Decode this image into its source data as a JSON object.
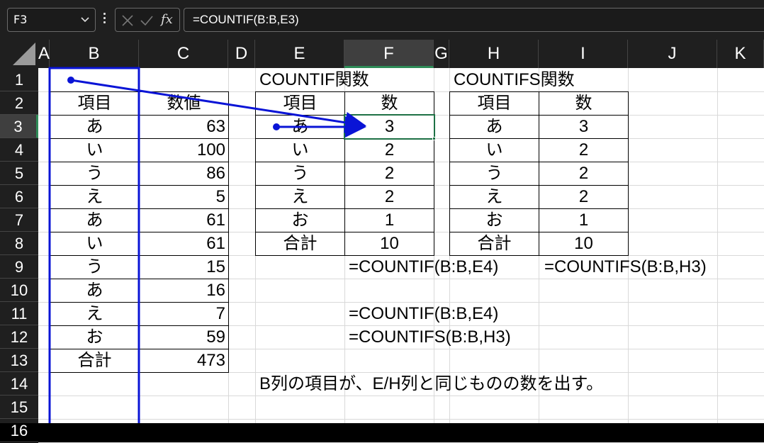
{
  "formula_bar": {
    "name_box": "F3",
    "formula": "=COUNTIF(B:B,E3)",
    "icons": [
      "chevron-down-icon",
      "more-icon",
      "cancel-icon",
      "confirm-icon",
      "function-icon"
    ],
    "fx_label": "fx"
  },
  "columns": [
    "A",
    "B",
    "C",
    "D",
    "E",
    "F",
    "G",
    "H",
    "I",
    "J",
    "K"
  ],
  "rows": [
    "1",
    "2",
    "3",
    "4",
    "5",
    "6",
    "7",
    "8",
    "9",
    "10",
    "11",
    "12",
    "13",
    "14",
    "15",
    "16"
  ],
  "data_table": {
    "header": [
      "項目",
      "数値"
    ],
    "rows": [
      [
        "あ",
        "63"
      ],
      [
        "い",
        "100"
      ],
      [
        "う",
        "86"
      ],
      [
        "え",
        "5"
      ],
      [
        "あ",
        "61"
      ],
      [
        "い",
        "61"
      ],
      [
        "う",
        "15"
      ],
      [
        "あ",
        "16"
      ],
      [
        "え",
        "7"
      ],
      [
        "お",
        "59"
      ],
      [
        "合計",
        "473"
      ]
    ]
  },
  "countif_table": {
    "title": "COUNTIF関数",
    "header": [
      "項目",
      "数"
    ],
    "rows": [
      [
        "あ",
        "3"
      ],
      [
        "い",
        "2"
      ],
      [
        "う",
        "2"
      ],
      [
        "え",
        "2"
      ],
      [
        "お",
        "1"
      ],
      [
        "合計",
        "10"
      ]
    ]
  },
  "countifs_table": {
    "title": "COUNTIFS関数",
    "header": [
      "項目",
      "数"
    ],
    "rows": [
      [
        "あ",
        "3"
      ],
      [
        "い",
        "2"
      ],
      [
        "う",
        "2"
      ],
      [
        "え",
        "2"
      ],
      [
        "お",
        "1"
      ],
      [
        "合計",
        "10"
      ]
    ]
  },
  "notes": {
    "row9_countif": "=COUNTIF(B:B,E4)",
    "row9_countifs": "=COUNTIFS(B:B,H3)",
    "row11": "=COUNTIF(B:B,E4)",
    "row12": "=COUNTIFS(B:B,H3)",
    "row14": "B列の項目が、E/H列と同じものの数を出す。"
  },
  "colors": {
    "dark_bg": "#1f1f1f",
    "sheet_white": "#ffffff",
    "annotation_blue": "#0a14d6",
    "selection_green": "#1e7145"
  }
}
